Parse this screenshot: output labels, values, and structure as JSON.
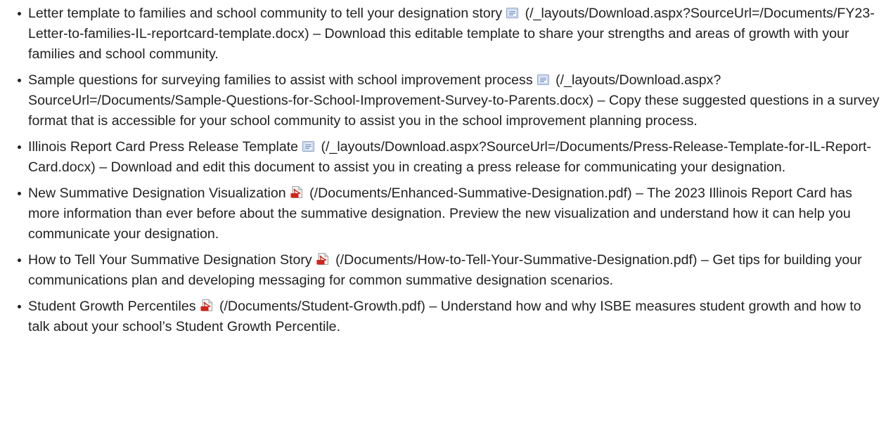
{
  "items": [
    {
      "title": "Letter template to families and school community to tell your designation story",
      "icon": "word-doc-icon",
      "url": "(/_layouts/Download.aspx?SourceUrl=/Documents/FY23-Letter-to-families-IL-reportcard-template.docx)",
      "separator": "–",
      "description": "Download this editable template to share your strengths and areas of growth with your families and school community."
    },
    {
      "title": "Sample questions for surveying families to assist with school improvement process",
      "icon": "word-doc-icon",
      "url": "(/_layouts/Download.aspx?SourceUrl=/Documents/Sample-Questions-for-School-Improvement-Survey-to-Parents.docx)",
      "separator": "–",
      "description": "Copy these suggested questions in a survey format that is accessible for your school community to assist you in the school improvement planning process."
    },
    {
      "title": "Illinois Report Card Press Release Template",
      "icon": "word-doc-icon",
      "url": "(/_layouts/Download.aspx?SourceUrl=/Documents/Press-Release-Template-for-IL-Report-Card.docx)",
      "separator": "–",
      "description": "Download and edit this document to assist you in creating a press release for communicating your designation."
    },
    {
      "title": "New Summative Designation Visualization",
      "icon": "pdf-icon",
      "url": "(/Documents/Enhanced-Summative-Designation.pdf)",
      "separator": "–",
      "description": "The 2023 Illinois Report Card has more information than ever before about the summative designation. Preview the new visualization and understand how it can help you communicate your designation."
    },
    {
      "title": "How to Tell Your Summative Designation Story",
      "icon": "pdf-icon",
      "url": "(/Documents/How-to-Tell-Your-Summative-Designation.pdf)",
      "separator": "–",
      "description": "Get tips for building your communications plan and developing messaging for common summative designation scenarios."
    },
    {
      "title": "Student Growth Percentiles",
      "icon": "pdf-icon",
      "url": "(/Documents/Student-Growth.pdf)",
      "separator": "–",
      "description": "Understand how and why ISBE measures student growth and how to talk about your school’s Student Growth Percentile."
    }
  ]
}
